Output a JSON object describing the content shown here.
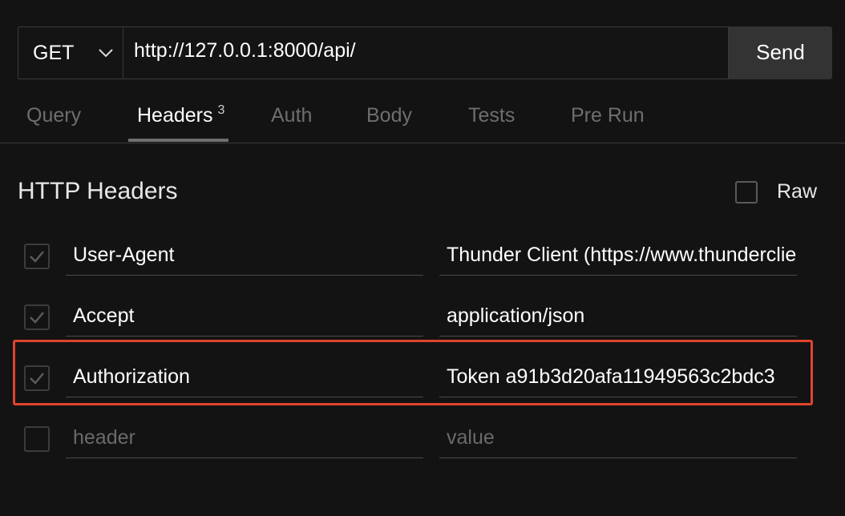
{
  "request": {
    "method": "GET",
    "url": "http://127.0.0.1:8000/api/",
    "send_label": "Send"
  },
  "tabs": [
    {
      "label": "Query",
      "active": false
    },
    {
      "label": "Headers",
      "badge": "3",
      "active": true
    },
    {
      "label": "Auth",
      "active": false
    },
    {
      "label": "Body",
      "active": false
    },
    {
      "label": "Tests",
      "active": false
    },
    {
      "label": "Pre Run",
      "active": false
    }
  ],
  "headers_section": {
    "title": "HTTP Headers",
    "raw_label": "Raw",
    "raw_checked": false,
    "rows": [
      {
        "key": "User-Agent",
        "value": "Thunder Client (https://www.thunderclient.com)",
        "checked": true
      },
      {
        "key": "Accept",
        "value": "application/json",
        "checked": true
      },
      {
        "key": "Authorization",
        "value": "Token a91b3d20afa11949563c2bdc3",
        "checked": true
      }
    ],
    "new_row": {
      "key_placeholder": "header",
      "value_placeholder": "value",
      "checked": false
    }
  },
  "colors": {
    "background": "#131313",
    "highlight": "#e0442e"
  }
}
